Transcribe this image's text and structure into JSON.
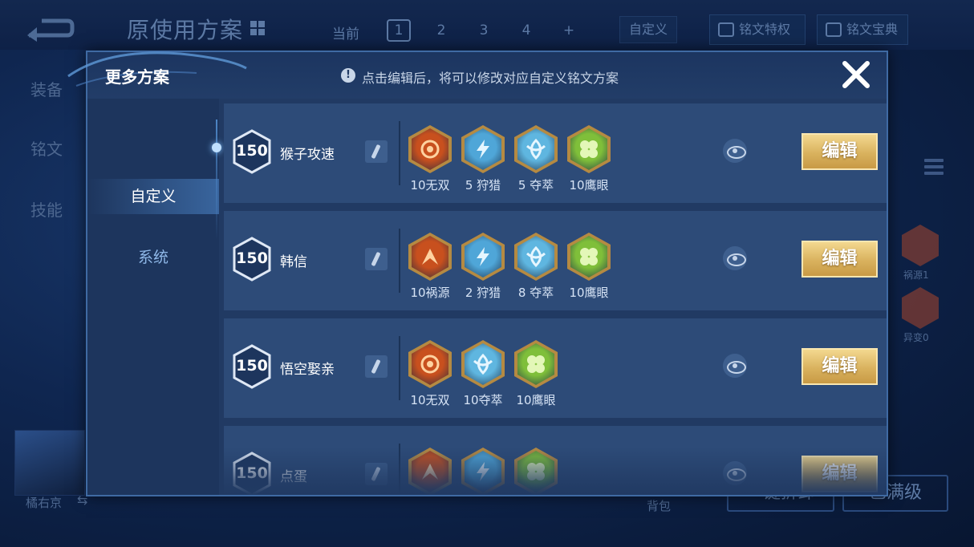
{
  "topbar": {
    "title": "原使用方案",
    "current_label": "当前",
    "pages": [
      "1",
      "2",
      "3",
      "4",
      "+"
    ],
    "active_page": "1",
    "custom_label": "自定义",
    "privilege_label": "铭文特权",
    "codex_label": "铭文宝典"
  },
  "left_tabs": [
    "装备",
    "铭文",
    "技能"
  ],
  "hero": {
    "name": "橘右京",
    "swap_icon": "⇆"
  },
  "right_runes": [
    {
      "label": "祸源1",
      "color": "#b84a2a"
    },
    {
      "label": "异变0",
      "color": "#b84a2a"
    }
  ],
  "bottom": {
    "bag_label": "背包",
    "button_a": "一键拆卸",
    "button_b": "已满级"
  },
  "modal": {
    "title": "更多方案",
    "info_icon": "!",
    "hint": "点击编辑后，将可以修改对应自定义铭文方案",
    "close_icon": "close-icon",
    "tabs": [
      {
        "label": "自定义",
        "active": true
      },
      {
        "label": "系统",
        "active": false
      }
    ],
    "rows": [
      {
        "level": "150",
        "name": "猴子攻速",
        "edit_label": "编辑",
        "runes": [
          {
            "label": "10无双",
            "color": "#c8501e",
            "glyph": "rose"
          },
          {
            "label": "5 狩猎",
            "color": "#4fa6d8",
            "glyph": "bolt"
          },
          {
            "label": "5 夺萃",
            "color": "#5fb6e0",
            "glyph": "knot"
          },
          {
            "label": "10鹰眼",
            "color": "#7fbf3a",
            "glyph": "clover"
          }
        ]
      },
      {
        "level": "150",
        "name": "韩信",
        "edit_label": "编辑",
        "runes": [
          {
            "label": "10祸源",
            "color": "#c8501e",
            "glyph": "flame"
          },
          {
            "label": "2 狩猎",
            "color": "#4fa6d8",
            "glyph": "bolt"
          },
          {
            "label": "8 夺萃",
            "color": "#5fb6e0",
            "glyph": "knot"
          },
          {
            "label": "10鹰眼",
            "color": "#7fbf3a",
            "glyph": "clover"
          }
        ]
      },
      {
        "level": "150",
        "name": "悟空娶亲",
        "edit_label": "编辑",
        "runes": [
          {
            "label": "10无双",
            "color": "#c8501e",
            "glyph": "rose"
          },
          {
            "label": "10夺萃",
            "color": "#5fb6e0",
            "glyph": "knot"
          },
          {
            "label": "10鹰眼",
            "color": "#7fbf3a",
            "glyph": "clover"
          }
        ]
      },
      {
        "level": "150",
        "name": "点蛋",
        "edit_label": "编辑",
        "runes": [
          {
            "label": "",
            "color": "#c8501e",
            "glyph": "flame"
          },
          {
            "label": "",
            "color": "#4fa6d8",
            "glyph": "bolt"
          },
          {
            "label": "",
            "color": "#7fbf3a",
            "glyph": "clover"
          }
        ]
      }
    ]
  }
}
